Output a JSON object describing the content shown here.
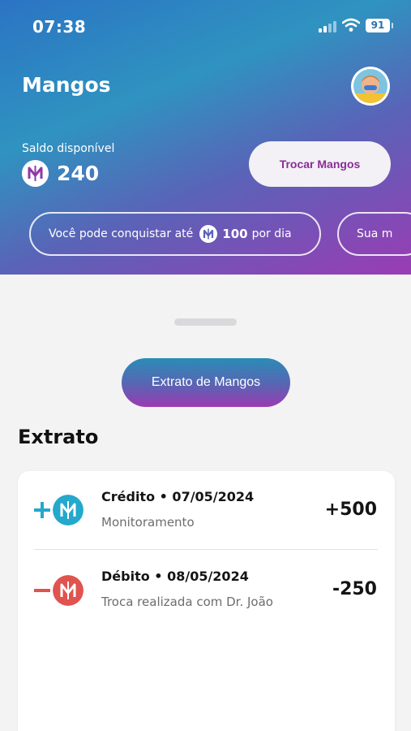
{
  "status_bar": {
    "time": "07:38",
    "battery": "91"
  },
  "header": {
    "title": "Mangos",
    "balance_label": "Saldo disponível",
    "balance_value": "240",
    "trade_button_label": "Trocar Mangos",
    "info_pills": [
      {
        "prefix": "Você pode conquistar até",
        "amount": "100",
        "suffix": "por dia"
      },
      {
        "text": "Sua m"
      }
    ]
  },
  "main": {
    "statement_button_label": "Extrato de Mangos",
    "section_title": "Extrato"
  },
  "transactions": [
    {
      "type": "credit",
      "sign": "+",
      "title": "Crédito • 07/05/2024",
      "subtitle": "Monitoramento",
      "amount": "+500",
      "color": "#24a8cc"
    },
    {
      "type": "debit",
      "sign": "−",
      "title": "Débito • 08/05/2024",
      "subtitle": "Troca realizada com Dr. João",
      "amount": "-250",
      "color": "#e0534e"
    }
  ],
  "icons": {
    "avatar": "user-avatar",
    "coin": "mango-coin-icon",
    "status": [
      "signal-icon",
      "wifi-icon",
      "battery-icon"
    ]
  },
  "colors": {
    "header_gradient_start": "#2b74c4",
    "header_gradient_end": "#9a3cb4",
    "accent_purple": "#8a2d95",
    "credit": "#24a8cc",
    "debit": "#e0534e"
  }
}
